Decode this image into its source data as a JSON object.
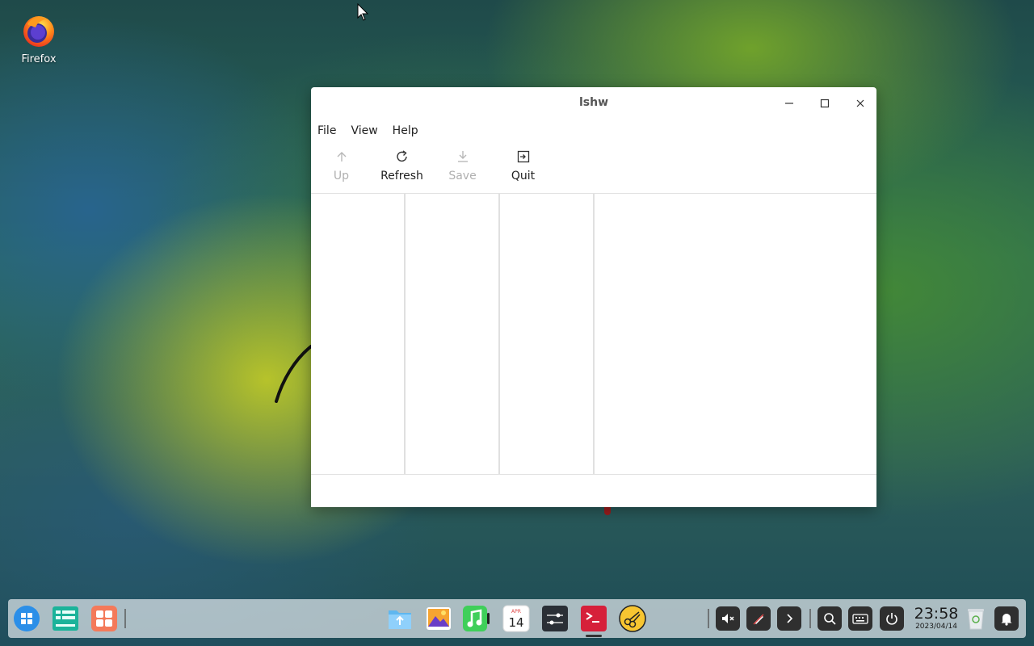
{
  "desktop": {
    "icons": [
      {
        "label": "Firefox"
      }
    ]
  },
  "window": {
    "title": "lshw",
    "menu": [
      "File",
      "View",
      "Help"
    ],
    "toolbar": [
      {
        "label": "Up",
        "icon": "arrow-up-icon",
        "enabled": false
      },
      {
        "label": "Refresh",
        "icon": "refresh-icon",
        "enabled": true
      },
      {
        "label": "Save",
        "icon": "save-icon",
        "enabled": false
      },
      {
        "label": "Quit",
        "icon": "exit-icon",
        "enabled": true
      }
    ]
  },
  "taskbar": {
    "clock": {
      "time": "23:58",
      "date": "2023/04/14"
    },
    "calendar_day": "14",
    "calendar_month": "APR"
  },
  "colors": {
    "taskbar_bg": "#e1e8ec",
    "window_bg": "#ffffff",
    "disabled_text": "#b0b0b0",
    "terminal_red": "#d6203a"
  }
}
